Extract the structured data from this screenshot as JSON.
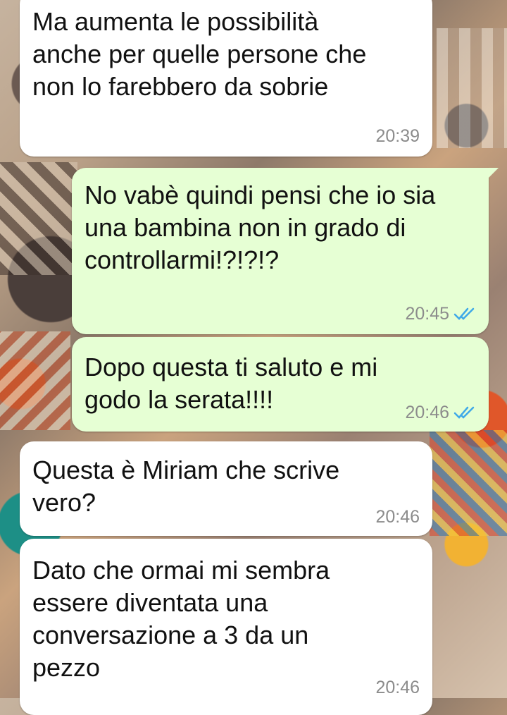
{
  "messages": [
    {
      "direction": "incoming",
      "text": "Ma aumenta le possibilità anche per quelle persone che non lo farebbero da sobrie",
      "time": "20:39"
    },
    {
      "direction": "outgoing",
      "text": "No vabè quindi pensi che io sia una bambina non in grado di controllarmi!?!?!?",
      "time": "20:45",
      "status": "read"
    },
    {
      "direction": "outgoing",
      "text": "Dopo questa ti saluto e mi godo la serata!!!!",
      "time": "20:46",
      "status": "read"
    },
    {
      "direction": "incoming",
      "text": "Questa è Miriam che scrive vero?",
      "time": "20:46"
    },
    {
      "direction": "incoming",
      "text": "Dato che ormai mi sembra essere diventata una conversazione a 3 da un pezzo",
      "time": "20:46"
    }
  ],
  "colors": {
    "incoming_bubble": "#ffffff",
    "outgoing_bubble": "#e6ffd4",
    "read_ticks": "#3fa9e8",
    "timestamp": "#8c8c8c"
  },
  "icons": [
    "double-check-icon"
  ]
}
